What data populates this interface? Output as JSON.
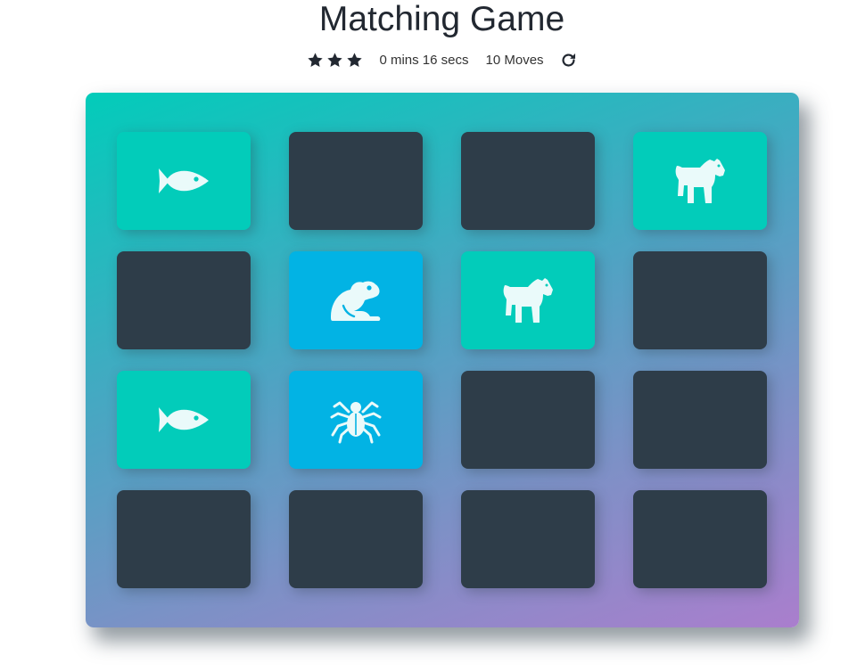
{
  "header": {
    "title": "Matching Game"
  },
  "score_panel": {
    "stars_count": 3,
    "timer_text": "0 mins 16 secs",
    "moves_text": "10 Moves",
    "restart_icon": "redo-icon",
    "star_icon": "star-icon"
  },
  "colors": {
    "card_hidden": "#2e3d49",
    "card_matched": "#02ccba",
    "card_open": "#02b3e4",
    "board_gradient_start": "#02ccba",
    "board_gradient_end": "#aa7ecd"
  },
  "board": {
    "cards": [
      {
        "state": "match",
        "icon": "fish-icon"
      },
      {
        "state": "hidden",
        "icon": ""
      },
      {
        "state": "hidden",
        "icon": ""
      },
      {
        "state": "match",
        "icon": "horse-icon"
      },
      {
        "state": "hidden",
        "icon": ""
      },
      {
        "state": "open",
        "icon": "frog-icon"
      },
      {
        "state": "match",
        "icon": "horse-icon"
      },
      {
        "state": "hidden",
        "icon": ""
      },
      {
        "state": "match",
        "icon": "fish-icon"
      },
      {
        "state": "open",
        "icon": "spider-icon"
      },
      {
        "state": "hidden",
        "icon": ""
      },
      {
        "state": "hidden",
        "icon": ""
      },
      {
        "state": "hidden",
        "icon": ""
      },
      {
        "state": "hidden",
        "icon": ""
      },
      {
        "state": "hidden",
        "icon": ""
      },
      {
        "state": "hidden",
        "icon": ""
      }
    ]
  }
}
